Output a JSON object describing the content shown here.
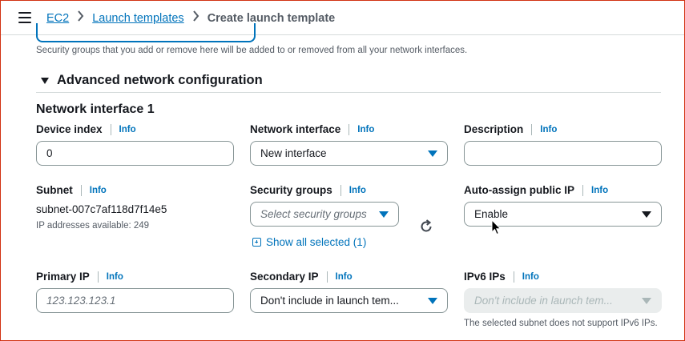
{
  "breadcrumb": {
    "items": [
      "EC2",
      "Launch templates"
    ],
    "current": "Create launch template"
  },
  "security_groups_help": "Security groups that you add or remove here will be added to or removed from all your network interfaces.",
  "advanced_section": {
    "title": "Advanced network configuration",
    "expanded": true
  },
  "network_interface": {
    "title": "Network interface 1",
    "info_label": "Info",
    "device_index": {
      "label": "Device index",
      "value": "0"
    },
    "network_interface": {
      "label": "Network interface",
      "value": "New interface"
    },
    "description": {
      "label": "Description",
      "value": ""
    },
    "subnet": {
      "label": "Subnet",
      "value": "subnet-007c7af118d7f14e5",
      "help": "IP addresses available: 249"
    },
    "security_groups": {
      "label": "Security groups",
      "placeholder": "Select security groups",
      "show_all_label": "Show all selected (1)"
    },
    "auto_assign_ip": {
      "label": "Auto-assign public IP",
      "value": "Enable"
    },
    "primary_ip": {
      "label": "Primary IP",
      "placeholder": "123.123.123.1"
    },
    "secondary_ip": {
      "label": "Secondary IP",
      "value": "Don't include in launch tem..."
    },
    "ipv6_ips": {
      "label": "IPv6 IPs",
      "value": "Don't include in launch tem...",
      "help": "The selected subnet does not support IPv6 IPs.",
      "disabled": true
    }
  },
  "colors": {
    "link": "#0073bb",
    "text": "#16191f",
    "muted": "#545b64",
    "border": "#879596",
    "window_border": "#d13212"
  },
  "icons": [
    "menu-icon",
    "chevron-right-icon",
    "caret-down-icon",
    "refresh-icon",
    "plus-square-icon",
    "mouse-pointer-icon"
  ]
}
